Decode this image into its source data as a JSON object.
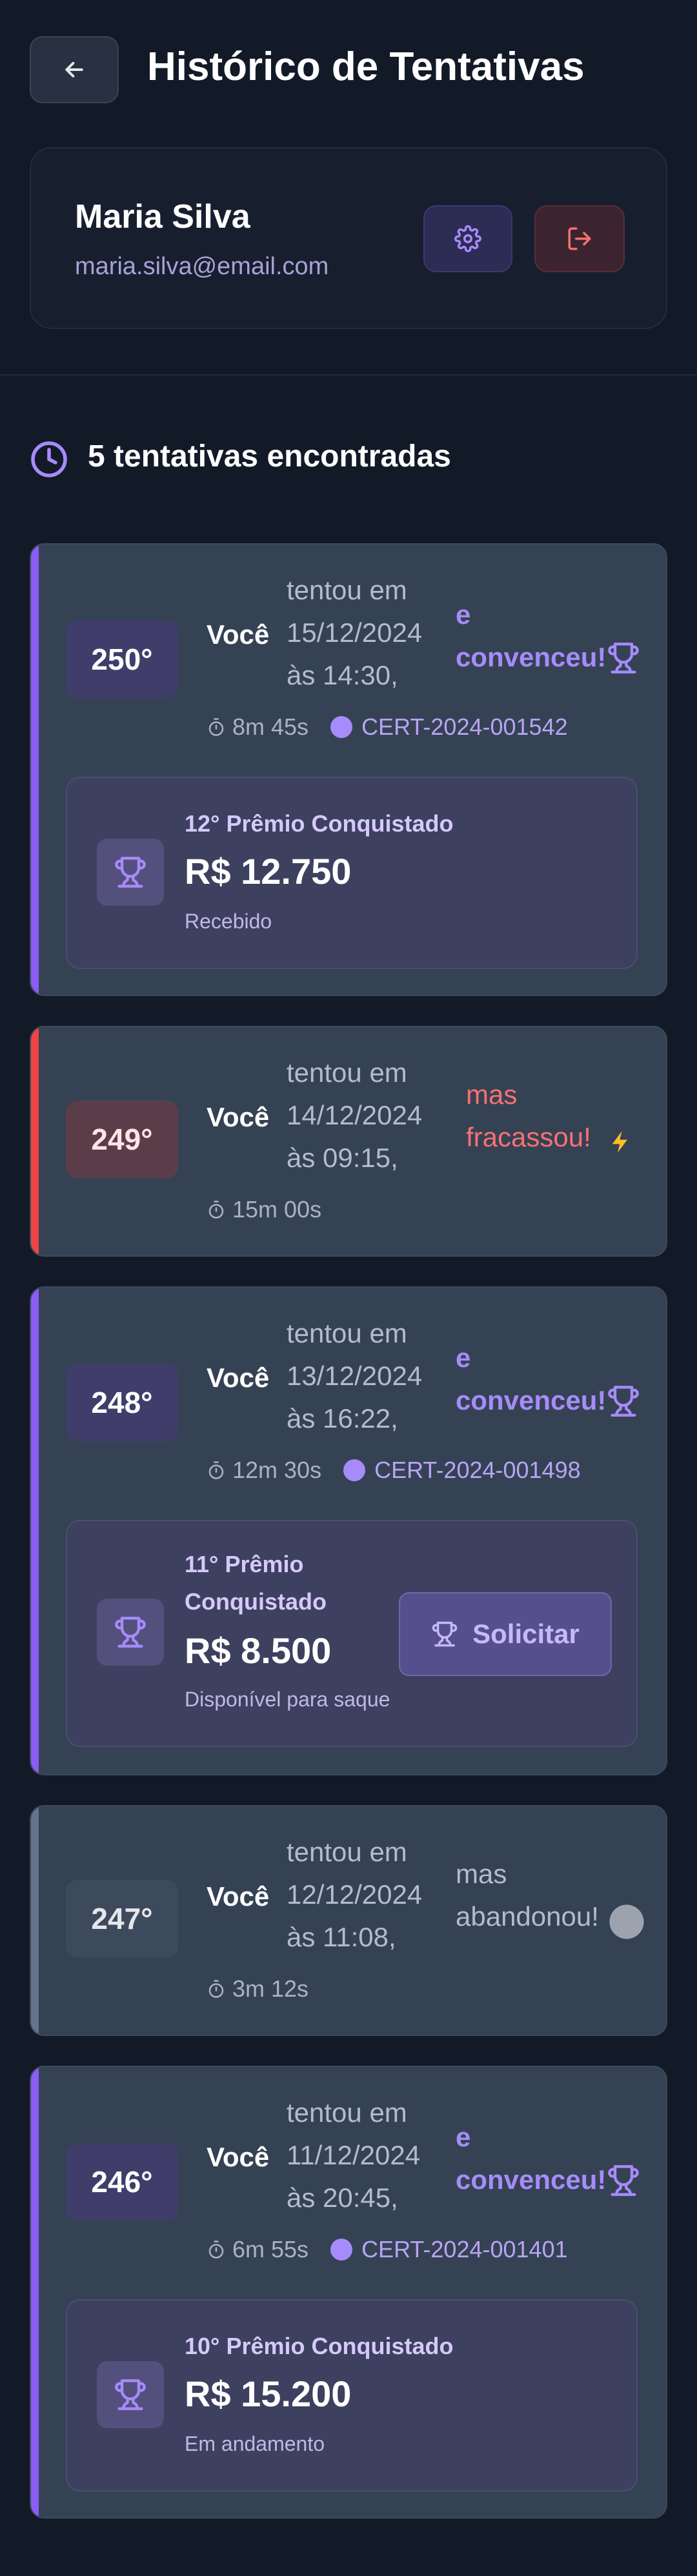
{
  "header": {
    "title": "Histórico de Tentativas"
  },
  "user": {
    "name": "Maria Silva",
    "email": "maria.silva@email.com"
  },
  "summary": {
    "count_text": "5 tentativas encontradas"
  },
  "colors": {
    "accent": "#8b5cf6",
    "success_text": "#a78bfa",
    "fail": "#ef4444",
    "fail_text": "#f87171",
    "neutral": "#64748b"
  },
  "attempts": [
    {
      "degree": "250°",
      "who": "Você",
      "when": [
        "tentou em",
        "15/12/2024",
        "às 14:30,"
      ],
      "outcome": [
        "e",
        "convenceu!"
      ],
      "outcome_icon": "trophy-icon",
      "status": "success",
      "duration": "8m 45s",
      "certificate": "CERT-2024-001542",
      "prize": {
        "label": "12° Prêmio Conquistado",
        "value": "R$ 12.750",
        "status": "Recebido"
      }
    },
    {
      "degree": "249°",
      "who": "Você",
      "when": [
        "tentou em",
        "14/12/2024",
        "às 09:15,"
      ],
      "outcome": [
        "mas",
        "fracassou!"
      ],
      "outcome_icon": "lightning-icon",
      "status": "fail",
      "duration": "15m 00s"
    },
    {
      "degree": "248°",
      "who": "Você",
      "when": [
        "tentou em",
        "13/12/2024",
        "às 16:22,"
      ],
      "outcome": [
        "e",
        "convenceu!"
      ],
      "outcome_icon": "trophy-icon",
      "status": "success",
      "duration": "12m 30s",
      "certificate": "CERT-2024-001498",
      "prize": {
        "label": [
          "11° Prêmio",
          "Conquistado"
        ],
        "value": "R$ 8.500",
        "status": "Disponível para saque",
        "button": "Solicitar"
      }
    },
    {
      "degree": "247°",
      "who": "Você",
      "when": [
        "tentou em",
        "12/12/2024",
        "às 11:08,"
      ],
      "outcome": [
        "mas",
        "abandonou!"
      ],
      "outcome_icon": "circle-icon",
      "status": "abandoned",
      "duration": "3m 12s"
    },
    {
      "degree": "246°",
      "who": "Você",
      "when": [
        "tentou em",
        "11/12/2024",
        "às 20:45,"
      ],
      "outcome": [
        "e",
        "convenceu!"
      ],
      "outcome_icon": "trophy-icon",
      "status": "success",
      "duration": "6m 55s",
      "certificate": "CERT-2024-001401",
      "prize": {
        "label": "10° Prêmio Conquistado",
        "value": "R$ 15.200",
        "status": "Em andamento"
      }
    }
  ]
}
